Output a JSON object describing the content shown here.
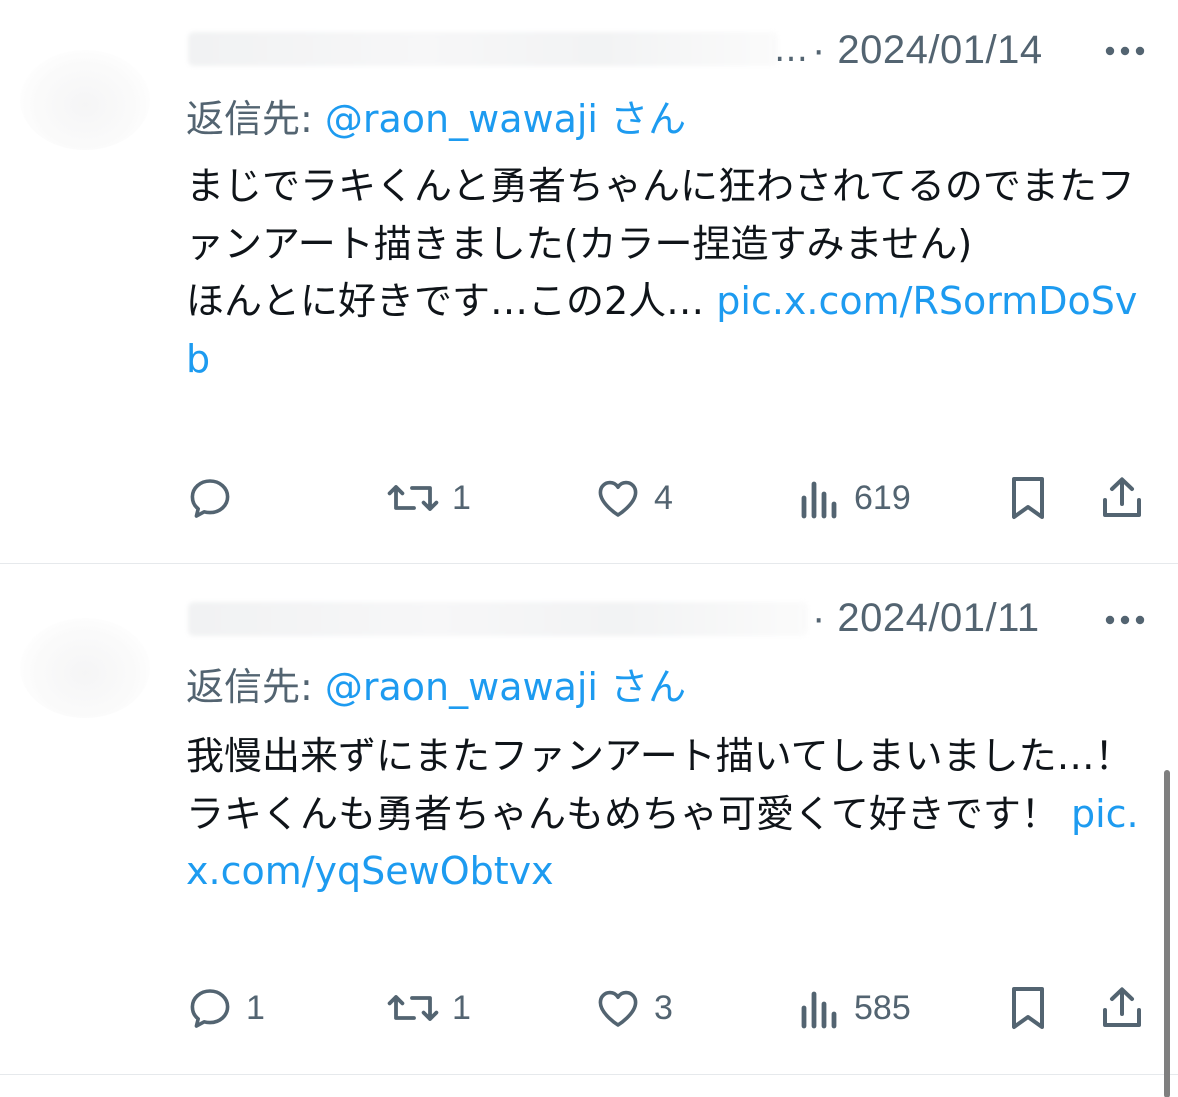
{
  "tweets": [
    {
      "name_truncation": "…",
      "date": "· 2024/01/14",
      "reply_prefix": "返信先: ",
      "reply_handle": "@raon_wawaji",
      "reply_suffix": " さん",
      "text": "まじでラキくんと勇者ちゃんに狂わされてるのでまたファンアート描きました(カラー捏造すみません)\nほんとに好きです…この2人… ",
      "link": "pic.x.com/RSormDoSvb",
      "reply_count": "",
      "retweet_count": "1",
      "like_count": "4",
      "view_count": "619"
    },
    {
      "name_truncation": "",
      "date": "· 2024/01/11",
      "reply_prefix": "返信先: ",
      "reply_handle": "@raon_wawaji",
      "reply_suffix": " さん",
      "text": "我慢出来ずにまたファンアート描いてしまいました…！\nラキくんも勇者ちゃんもめちゃ可愛くて好きです！ ",
      "link": "pic.x.com/yqSewObtvx",
      "reply_count": "1",
      "retweet_count": "1",
      "like_count": "3",
      "view_count": "585"
    }
  ],
  "icons": {
    "reply": "reply-icon",
    "retweet": "retweet-icon",
    "like": "heart-icon",
    "views": "views-icon",
    "bookmark": "bookmark-icon",
    "share": "share-icon",
    "more": "more-icon"
  },
  "colors": {
    "link": "#1d9bf0",
    "secondary_text": "#536471",
    "primary_text": "#0f1419"
  }
}
